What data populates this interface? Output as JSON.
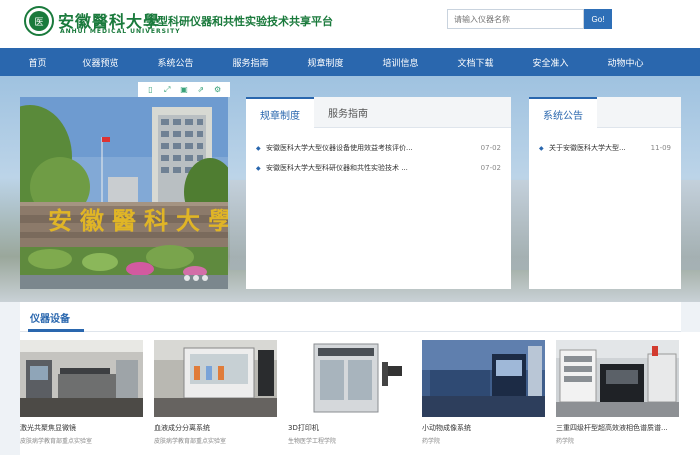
{
  "header": {
    "logo_char": "医",
    "brand_cn": "安徽醫科大學",
    "brand_en": "ANHUI MEDICAL UNIVERSITY",
    "platform_title": "大型科研仪器和共性实验技术共享平台",
    "search_placeholder": "请输入仪器名称",
    "search_button": "Go!"
  },
  "nav": {
    "items": [
      "首页",
      "仪器预览",
      "系统公告",
      "服务指南",
      "规章制度",
      "培训信息",
      "文档下载",
      "安全准入",
      "动物中心"
    ]
  },
  "slider": {
    "toolbar_icons": [
      "bookmark-icon",
      "expand-icon",
      "save-icon",
      "share-icon",
      "settings-icon"
    ],
    "toolbar_glyphs": [
      "▯",
      "⤢",
      "▣",
      "⇗",
      "⚙"
    ],
    "dot_count": 3
  },
  "rules_panel": {
    "tabs": [
      "规章制度",
      "服务指南"
    ],
    "active_tab": 0,
    "items": [
      {
        "title": "安徽医科大学大型仪器设备使用效益考核评价...",
        "date": "07-02"
      },
      {
        "title": "安徽医科大学大型科研仪器和共性实验技术 ...",
        "date": "07-02"
      }
    ]
  },
  "notice_panel": {
    "tab": "系统公告",
    "items": [
      {
        "title": "关于安徽医科大学大型...",
        "date": "11-09"
      }
    ]
  },
  "equipment": {
    "section_title": "仪器设备",
    "items": [
      {
        "name": "激光共聚焦显微镜",
        "dept": "皮肤病学教育部重点实验室"
      },
      {
        "name": "血液成分分离系统",
        "dept": "皮肤病学教育部重点实验室"
      },
      {
        "name": "3D打印机",
        "dept": "生物医学工程学院"
      },
      {
        "name": "小动物成像系统",
        "dept": "药学院"
      },
      {
        "name": "三重四级杆型超高效液相色谱质谱...",
        "dept": "药学院"
      }
    ]
  },
  "colors": {
    "brand_green": "#1a7a3c",
    "nav_blue": "#2a67ae",
    "page_bg": "#eef2f6"
  }
}
